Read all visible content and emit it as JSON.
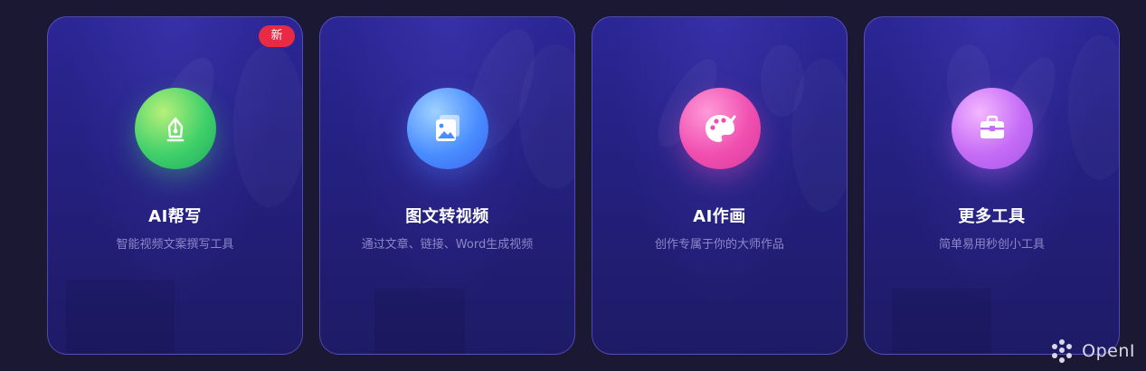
{
  "cards": [
    {
      "title": "AI帮写",
      "description": "智能视频文案撰写工具",
      "icon": "pen-nib-icon",
      "badge": "新",
      "accent": "#3fd06a"
    },
    {
      "title": "图文转视频",
      "description": "通过文章、链接、Word生成视频",
      "icon": "image-stack-icon",
      "accent": "#4a8dff"
    },
    {
      "title": "AI作画",
      "description": "创作专属于你的大师作品",
      "icon": "palette-brush-icon",
      "accent": "#f04fb0"
    },
    {
      "title": "更多工具",
      "description": "简单易用秒创小工具",
      "icon": "toolbox-icon",
      "accent": "#c56cf6"
    }
  ],
  "watermark": {
    "text": "OpenI",
    "icon": "openi-logo-icon"
  },
  "colors": {
    "background": "#1b1833",
    "card_top": "#2b2695",
    "card_bottom": "#1e1b66",
    "badge": "#e82a45",
    "description": "#8b88c9"
  }
}
